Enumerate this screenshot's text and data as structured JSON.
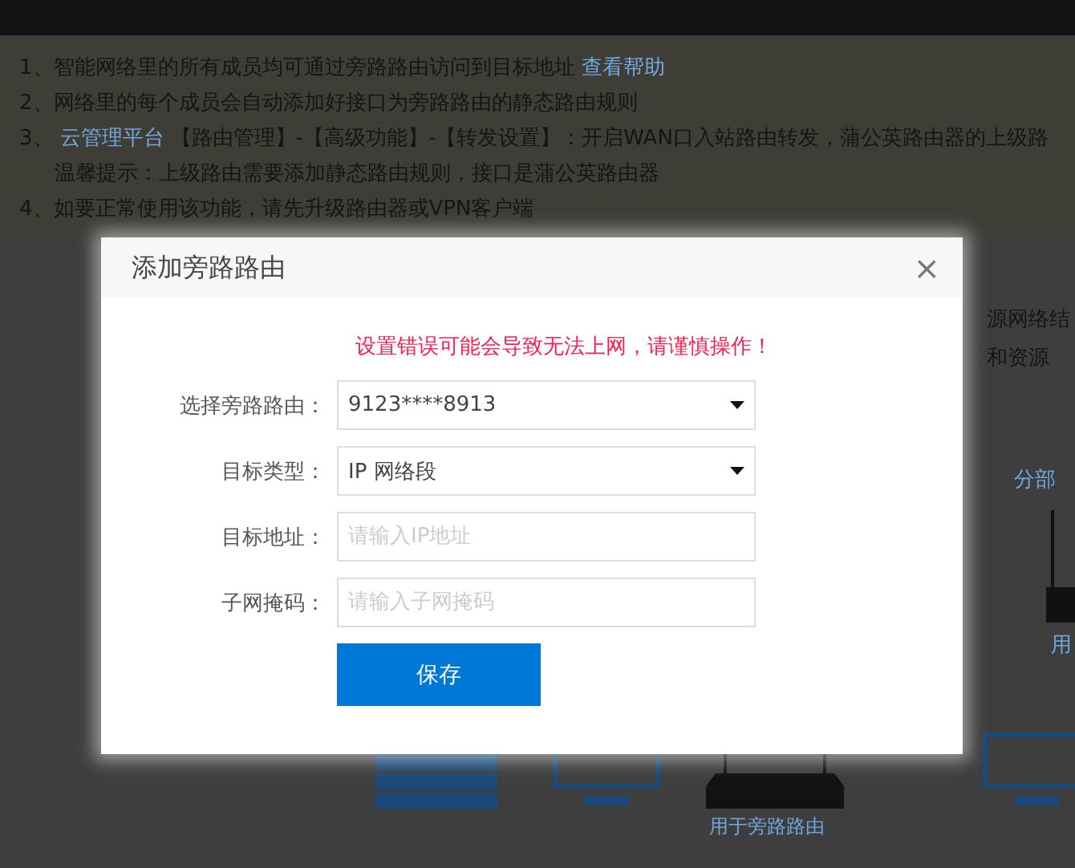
{
  "background_page": {
    "notes": [
      {
        "indent": false,
        "parts": [
          {
            "text": "1、智能网络里的所有成员均可通过旁路路由访问到目标地址",
            "link": false
          },
          {
            "text": "查看帮助",
            "link": true
          }
        ]
      },
      {
        "indent": false,
        "parts": [
          {
            "text": "2、网络里的每个成员会自动添加好接口为旁路路由的静态路由规则",
            "link": false
          }
        ]
      },
      {
        "indent": false,
        "parts": [
          {
            "text": "3、",
            "link": false
          },
          {
            "text": "云管理平台",
            "link": true
          },
          {
            "text": "【路由管理】-【高级功能】-【转发设置】：开启WAN口入站路由转发，蒲公英路由器的上级路",
            "link": false
          }
        ]
      },
      {
        "indent": true,
        "parts": [
          {
            "text": "温馨提示：上级路由需要添加静态路由规则，接口是蒲公英路由器",
            "link": false
          }
        ]
      },
      {
        "indent": false,
        "parts": [
          {
            "text": "4、如要正常使用该功能，请先升级路由器或VPN客户端",
            "link": false
          }
        ]
      }
    ],
    "side_texts": [
      "源网络结",
      "和资源"
    ],
    "branch_label": "分部",
    "branch_device_label": "用",
    "device_label": "用于旁路路由"
  },
  "dialog": {
    "title": "添加旁路路由",
    "close": "×",
    "warning": "设置错误可能会导致无法上网，请谨慎操作！",
    "fields": [
      {
        "kind": "select",
        "label": "选择旁路路由：",
        "value": "9123****8913"
      },
      {
        "kind": "select",
        "label": "目标类型：",
        "value": "IP 网络段"
      },
      {
        "kind": "input",
        "label": "目标地址：",
        "placeholder": "请输入IP地址"
      },
      {
        "kind": "input",
        "label": "子网掩码：",
        "placeholder": "请输入子网掩码"
      }
    ],
    "save_button": "保存"
  }
}
